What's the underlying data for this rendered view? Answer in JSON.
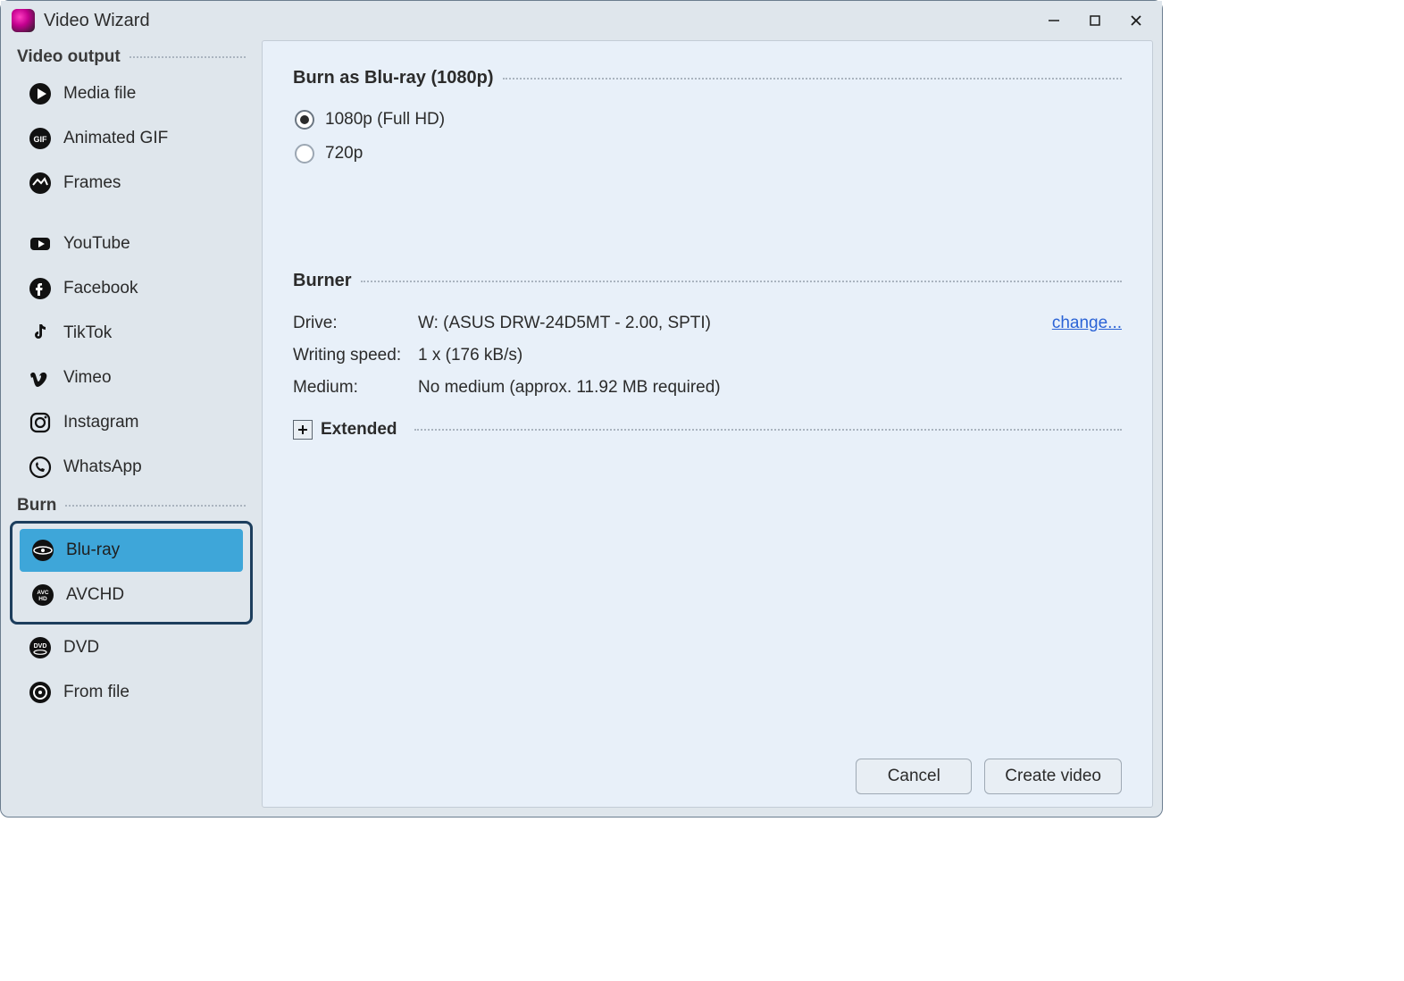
{
  "window": {
    "title": "Video Wizard"
  },
  "sidebar": {
    "section_output": "Video output",
    "section_burn": "Burn",
    "output_items": [
      {
        "label": "Media file"
      },
      {
        "label": "Animated GIF"
      },
      {
        "label": "Frames"
      },
      {
        "label": "YouTube"
      },
      {
        "label": "Facebook"
      },
      {
        "label": "TikTok"
      },
      {
        "label": "Vimeo"
      },
      {
        "label": "Instagram"
      },
      {
        "label": "WhatsApp"
      }
    ],
    "burn_items": [
      {
        "label": "Blu-ray"
      },
      {
        "label": "AVCHD"
      },
      {
        "label": "DVD"
      },
      {
        "label": "From file"
      }
    ]
  },
  "main": {
    "section_title": "Burn as Blu-ray (1080p)",
    "radios": {
      "r1": "1080p (Full HD)",
      "r2": "720p"
    },
    "burner": {
      "title": "Burner",
      "drive_label": "Drive:",
      "drive_value": "W: (ASUS DRW-24D5MT - 2.00, SPTI)",
      "change_label": "change...",
      "speed_label": "Writing speed:",
      "speed_value": "1 x (176 kB/s)",
      "medium_label": "Medium:",
      "medium_value": "No medium (approx. 11.92 MB required)"
    },
    "extended_label": "Extended"
  },
  "footer": {
    "cancel": "Cancel",
    "create": "Create video"
  }
}
